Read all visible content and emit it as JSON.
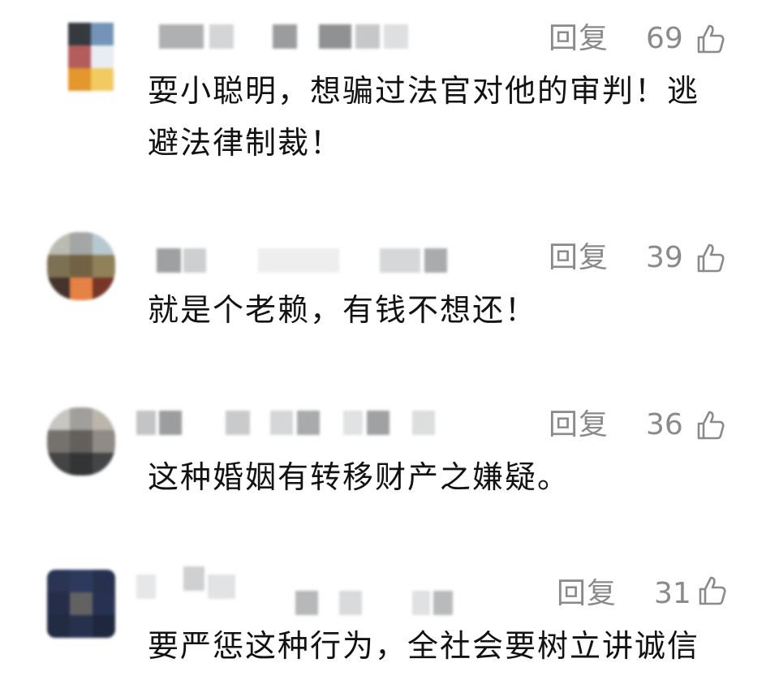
{
  "comments": [
    {
      "reply_label": "回复",
      "likes": "69",
      "lines": [
        "耍小聪明，想骗过法官对他的审判！逃",
        "避法律制裁！"
      ]
    },
    {
      "reply_label": "回复",
      "likes": "39",
      "lines": [
        "就是个老赖，有钱不想还！"
      ]
    },
    {
      "reply_label": "回复",
      "likes": "36",
      "lines": [
        "这种婚姻有转移财产之嫌疑。"
      ]
    },
    {
      "reply_label": "回复",
      "likes": "31",
      "lines": [
        "要严惩这种行为，全社会要树立讲诚信"
      ]
    }
  ],
  "icons": {
    "like": "thumbs-up-icon",
    "avatar": "user-avatar-pixelated"
  },
  "colors": {
    "text": "#121212",
    "meta": "#8a8a8a"
  }
}
